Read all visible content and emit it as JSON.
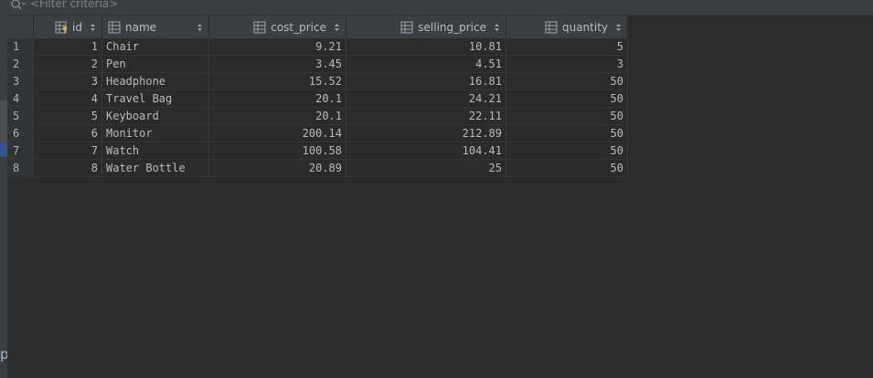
{
  "filter": {
    "placeholder": "<Filter criteria>"
  },
  "columns": [
    {
      "label": "id",
      "icon": "primary-key-column-icon"
    },
    {
      "label": "name",
      "icon": "column-icon"
    },
    {
      "label": "cost_price",
      "icon": "column-icon"
    },
    {
      "label": "selling_price",
      "icon": "column-icon"
    },
    {
      "label": "quantity",
      "icon": "column-icon"
    }
  ],
  "rows": [
    {
      "n": "1",
      "id": "1",
      "name": "Chair",
      "cost_price": "9.21",
      "selling_price": "10.81",
      "quantity": "5"
    },
    {
      "n": "2",
      "id": "2",
      "name": "Pen",
      "cost_price": "3.45",
      "selling_price": "4.51",
      "quantity": "3"
    },
    {
      "n": "3",
      "id": "3",
      "name": "Headphone",
      "cost_price": "15.52",
      "selling_price": "16.81",
      "quantity": "50"
    },
    {
      "n": "4",
      "id": "4",
      "name": "Travel Bag",
      "cost_price": "20.1",
      "selling_price": "24.21",
      "quantity": "50"
    },
    {
      "n": "5",
      "id": "5",
      "name": "Keyboard",
      "cost_price": "20.1",
      "selling_price": "22.11",
      "quantity": "50"
    },
    {
      "n": "6",
      "id": "6",
      "name": "Monitor",
      "cost_price": "200.14",
      "selling_price": "212.89",
      "quantity": "50"
    },
    {
      "n": "7",
      "id": "7",
      "name": "Watch",
      "cost_price": "100.58",
      "selling_price": "104.41",
      "quantity": "50"
    },
    {
      "n": "8",
      "id": "8",
      "name": "Water Bottle",
      "cost_price": "20.89",
      "selling_price": "25",
      "quantity": "50"
    }
  ],
  "side_glyph": "p",
  "colors": {
    "background": "#2b2b2b",
    "header": "#3c3f41",
    "text": "#bbbbbb"
  }
}
